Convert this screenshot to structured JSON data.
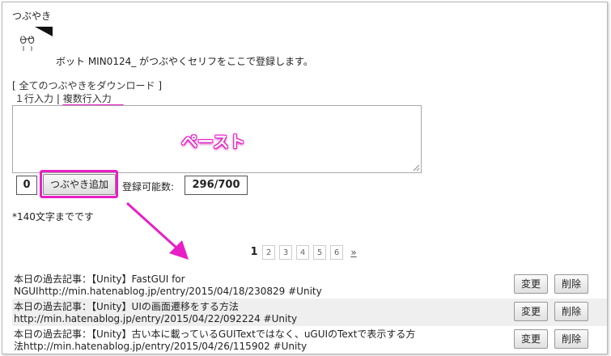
{
  "heading": "つぶやき",
  "intro": "ボット MIN0124_ がつぶやくセリフをここで登録します。",
  "links": {
    "download_prefix": "[ ",
    "download": "全てのつぶやきをダウンロード",
    "download_suffix": " ]",
    "single": "１行入力",
    "separator": " | ",
    "multi": "複数行入力"
  },
  "textarea": {
    "overlay": "ペースト"
  },
  "controls": {
    "count": "0",
    "add_button": "つぶやき追加",
    "capacity_label": "登録可能数:",
    "capacity_value": "296/700"
  },
  "note": "*140文字までです",
  "pagination": {
    "current": "1",
    "pages": [
      "2",
      "3",
      "4",
      "5",
      "6"
    ],
    "next": "»"
  },
  "tweets": [
    {
      "line1": "本日の過去記事：【Unity】FastGUI for",
      "line2": "NGUIhttp://min.hatenablog.jp/entry/2015/04/18/230829 #Unity",
      "edit": "変更",
      "delete": "削除"
    },
    {
      "line1": "本日の過去記事：【Unity】UIの画面遷移をする方法",
      "line2": "http://min.hatenablog.jp/entry/2015/04/22/092224 #Unity",
      "edit": "変更",
      "delete": "削除"
    },
    {
      "line1": "本日の過去記事：【Unity】古い本に載っているGUITextではなく、uGUIのTextで表示する方",
      "line2": "法http://min.hatenablog.jp/entry/2015/04/26/115902 #Unity",
      "edit": "変更",
      "delete": "削除"
    }
  ],
  "colors": {
    "highlight": "#e81fc6",
    "alt_row": "#efefef"
  }
}
